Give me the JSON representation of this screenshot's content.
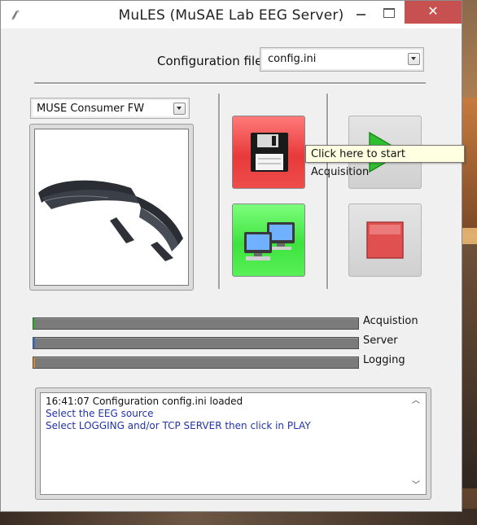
{
  "window": {
    "title": "MuLES (MuSAE Lab EEG Server)",
    "close_glyph": "✕"
  },
  "config": {
    "label": "Configuration file",
    "selected": "config.ini"
  },
  "device": {
    "selected": "MUSE Consumer FW",
    "image": "muse-headband-image"
  },
  "buttons": {
    "save": "floppy-disk-icon",
    "server": "network-computers-icon",
    "play": "play-icon",
    "stop": "stop-icon"
  },
  "tooltip": "Click here to start Acquisition",
  "progress": [
    {
      "label": "Acquistion",
      "value": 0.005,
      "color": "#1fb91f"
    },
    {
      "label": "Server",
      "value": 0.005,
      "color": "#2f6fd8"
    },
    {
      "label": "Logging",
      "value": 0.005,
      "color": "#e08a1e"
    }
  ],
  "log": {
    "lines": [
      "16:41:07  Configuration config.ini loaded",
      "Select the EEG source",
      "Select LOGGING and/or TCP SERVER then click in PLAY"
    ]
  },
  "colors": {
    "save_bg": "#e83a3a",
    "server_bg": "#3ee23e",
    "play_icon": "#2fbf2f",
    "stop_icon": "#e05050",
    "log_text": "#2233aa"
  }
}
